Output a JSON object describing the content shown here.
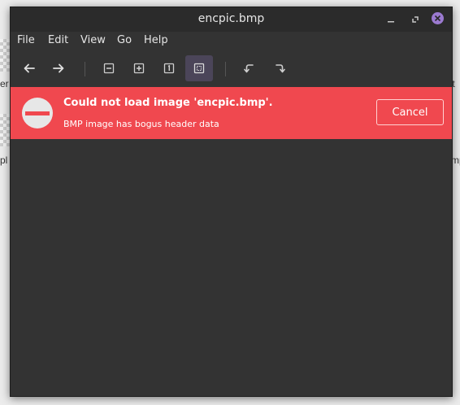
{
  "window": {
    "title": "encpic.bmp"
  },
  "menu": {
    "items": [
      "File",
      "Edit",
      "View",
      "Go",
      "Help"
    ]
  },
  "toolbar": {
    "buttons": [
      {
        "name": "back-icon"
      },
      {
        "name": "forward-icon"
      },
      {
        "name": "zoom-out-icon"
      },
      {
        "name": "zoom-in-icon"
      },
      {
        "name": "zoom-normal-icon"
      },
      {
        "name": "zoom-fit-icon",
        "active": true
      },
      {
        "name": "rotate-left-icon"
      },
      {
        "name": "rotate-right-icon"
      }
    ]
  },
  "error": {
    "title": "Could not load image 'encpic.bmp'.",
    "detail": "BMP image has bogus header data",
    "cancel_label": "Cancel"
  },
  "background": {
    "labels": [
      "er",
      "ıt",
      "pl",
      "mp"
    ]
  },
  "colors": {
    "error_bg": "#f0484f",
    "window_bg": "#333333",
    "titlebar_bg": "#2b2b2b",
    "close_button": "#9b7ad0",
    "active_tool": "#4b4559",
    "text": "#e6e6e6"
  }
}
